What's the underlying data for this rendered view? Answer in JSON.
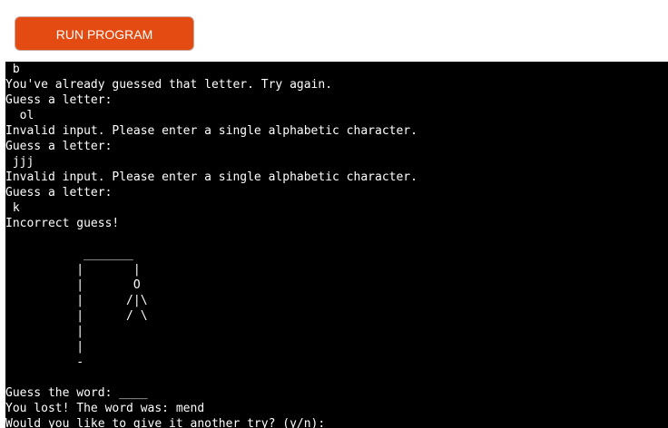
{
  "toolbar": {
    "run_label": "RUN PROGRAM"
  },
  "terminal": {
    "lines": [
      " b",
      "You've already guessed that letter. Try again.",
      "Guess a letter:",
      "  ol",
      "Invalid input. Please enter a single alphabetic character.",
      "Guess a letter:",
      " jjj",
      "Invalid input. Please enter a single alphabetic character.",
      "Guess a letter:",
      " k",
      "Incorrect guess!",
      "",
      "           _______",
      "          |       |",
      "          |       O",
      "          |      /|\\",
      "          |      / \\",
      "          |",
      "          |",
      "          -",
      "",
      "Guess the word: ____",
      "You lost! The word was: mend",
      "Would you like to give it another try? (y/n):"
    ]
  }
}
